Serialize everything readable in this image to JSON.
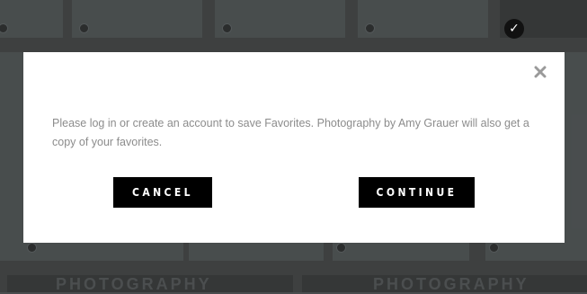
{
  "modal": {
    "message": "Please log in or create an account to save Favorites. Photography by Amy Grauer will also get a copy of your favorites.",
    "cancel_label": "CANCEL",
    "continue_label": "CONTINUE",
    "close_icon": "close-icon"
  },
  "background": {
    "watermark_left": "PHOTOGRAPHY",
    "watermark_right": "PHOTOGRAPHY",
    "selected_icon": "check-icon"
  },
  "colors": {
    "modal_bg": "#ffffff",
    "button_bg": "#000000",
    "message_text": "#8c8c8c",
    "backdrop": "#4a4d4e"
  }
}
